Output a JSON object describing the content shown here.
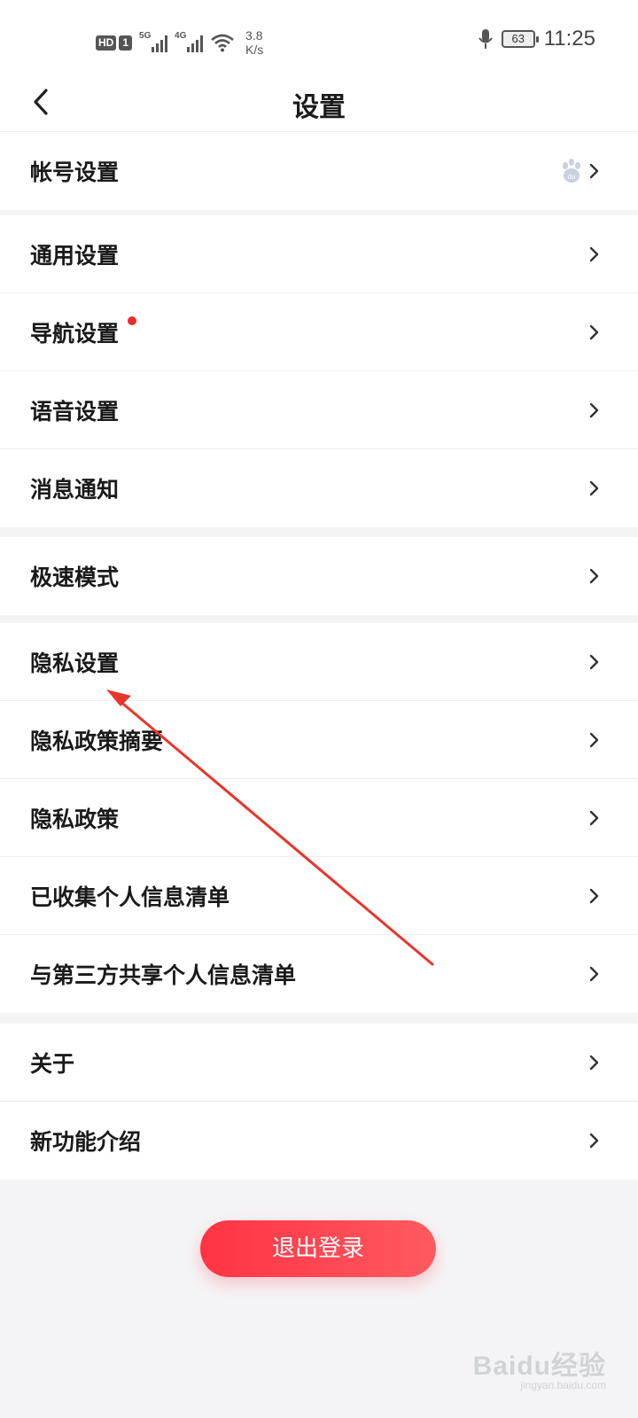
{
  "status_bar": {
    "hd": "HD",
    "sim": "1",
    "network1": "5G",
    "network2": "4G",
    "speed_value": "3.8",
    "speed_unit": "K/s",
    "battery": "63",
    "time": "11:25"
  },
  "header": {
    "title": "设置"
  },
  "groups": [
    {
      "items": [
        {
          "label": "帐号设置"
        }
      ]
    },
    {
      "items": [
        {
          "label": "通用设置"
        },
        {
          "label": "导航设置"
        },
        {
          "label": "语音设置"
        },
        {
          "label": "消息通知"
        }
      ]
    },
    {
      "items": [
        {
          "label": "极速模式"
        }
      ]
    },
    {
      "items": [
        {
          "label": "隐私设置"
        },
        {
          "label": "隐私政策摘要"
        },
        {
          "label": "隐私政策"
        },
        {
          "label": "已收集个人信息清单"
        },
        {
          "label": "与第三方共享个人信息清单"
        }
      ]
    },
    {
      "items": [
        {
          "label": "关于"
        },
        {
          "label": "新功能介绍"
        }
      ]
    }
  ],
  "logout_label": "退出登录",
  "watermark": {
    "brand": "Baidu经验",
    "url": "jingyan.baidu.com"
  },
  "colors": {
    "accent": "#ff3344",
    "badge_dot": "#ee2a2a",
    "annotation_arrow": "#e8352b"
  }
}
